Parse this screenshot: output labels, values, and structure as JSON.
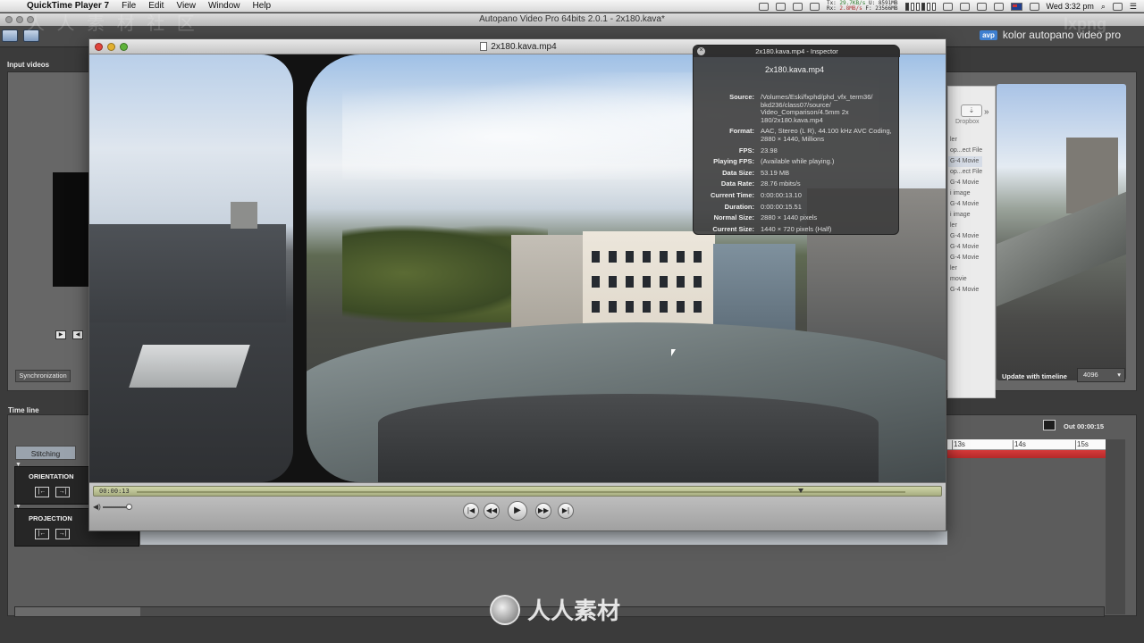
{
  "menubar": {
    "app_name": "QuickTime Player 7",
    "items": [
      "File",
      "Edit",
      "View",
      "Window",
      "Help"
    ],
    "net_up": "29.7KB/s",
    "net_down": "2.8MB/s",
    "mem_u": "8591MB",
    "mem_f": "23566MB",
    "net_tx_label": "Tx:",
    "net_rx_label": "Rx:",
    "mem_u_label": "U:",
    "mem_f_label": "F:",
    "clock": "Wed 3:32 pm"
  },
  "autopano": {
    "window_title": "Autopano Video Pro 64bits 2.0.1 - 2x180.kava*",
    "logo_badge": "avp",
    "logo_text": "kolor autopano video pro",
    "input_videos_label": "Input videos",
    "synchronization_button": "Synchronization",
    "update_with_timeline_label": "Update with timeline",
    "resolution_value": "4096",
    "timeline_label": "Time line",
    "stitching_tab": "Stitching",
    "orientation_track": "ORIENTATION",
    "projection_track": "PROJECTION",
    "out_label": "Out 00:00:15",
    "ruler_ticks": [
      "13s",
      "14s",
      "15s"
    ]
  },
  "dropbox": {
    "label": "Dropbox",
    "items": [
      {
        "text": "ler",
        "highlight": false
      },
      {
        "text": "op...ect File",
        "highlight": false
      },
      {
        "text": "G-4 Movie",
        "highlight": true
      },
      {
        "text": "op...ect File",
        "highlight": false
      },
      {
        "text": "G-4 Movie",
        "highlight": false
      },
      {
        "text": "i image",
        "highlight": false
      },
      {
        "text": "G-4 Movie",
        "highlight": false
      },
      {
        "text": "i image",
        "highlight": false
      },
      {
        "text": "ler",
        "highlight": false
      },
      {
        "text": "G-4 Movie",
        "highlight": false
      },
      {
        "text": "G-4 Movie",
        "highlight": false
      },
      {
        "text": "G-4 Movie",
        "highlight": false
      },
      {
        "text": "ler",
        "highlight": false
      },
      {
        "text": "movie",
        "highlight": false
      },
      {
        "text": "G-4 Movie",
        "highlight": false
      }
    ]
  },
  "quicktime": {
    "window_title": "2x180.kava.mp4",
    "current_time": "00:00:13",
    "progress_fraction": 0.86
  },
  "inspector": {
    "title": "2x180.kava.mp4 - Inspector",
    "file_name": "2x180.kava.mp4",
    "rows": [
      {
        "key": "Source:",
        "value": "/Volumes/Eski/fxphd/phd_vfx_term36/ bkd236/class07/source/ Video_Comparison/4.5mm 2x 180/2x180.kava.mp4"
      },
      {
        "key": "Format:",
        "value": "AAC, Stereo (L R), 44.100 kHz AVC Coding, 2880 × 1440, Millions"
      },
      {
        "key": "FPS:",
        "value": "23.98"
      },
      {
        "key": "Playing FPS:",
        "value": "(Available while playing.)"
      },
      {
        "key": "Data Size:",
        "value": "53.19 MB"
      },
      {
        "key": "Data Rate:",
        "value": "28.76 mbits/s"
      },
      {
        "key": "Current Time:",
        "value": "0:00:00:13.10"
      },
      {
        "key": "Duration:",
        "value": "0:00:00:15.51"
      },
      {
        "key": "Normal Size:",
        "value": "2880 × 1440 pixels"
      },
      {
        "key": "Current Size:",
        "value": "1440 × 720 pixels (Half)"
      }
    ]
  },
  "watermark": {
    "text": "人人素材",
    "top_left": "人 人 素 材 社 区",
    "top_right": "lxpng"
  }
}
